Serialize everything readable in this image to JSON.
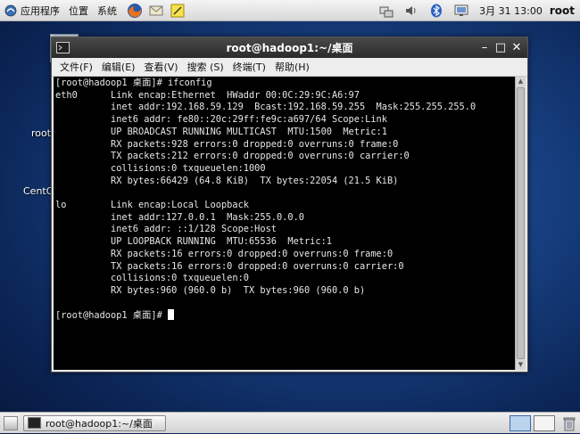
{
  "top_panel": {
    "applications": "应用程序",
    "places": "位置",
    "system": "系统",
    "launchers": [
      "firefox-icon",
      "email-icon",
      "notes-icon"
    ],
    "tray_icons": [
      "network-icon",
      "volume-icon",
      "bluetooth-icon",
      "display-icon"
    ],
    "clock": "3月 31 13:00",
    "user": "root"
  },
  "desktop": {
    "labels": [
      "root",
      "CentO"
    ]
  },
  "window": {
    "title": "root@hadoop1:~/桌面",
    "menu": [
      "文件(F)",
      "编辑(E)",
      "查看(V)",
      "搜索 (S)",
      "终端(T)",
      "帮助(H)"
    ],
    "terminal_lines": [
      "[root@hadoop1 桌面]# ifconfig",
      "eth0      Link encap:Ethernet  HWaddr 00:0C:29:9C:A6:97  ",
      "          inet addr:192.168.59.129  Bcast:192.168.59.255  Mask:255.255.255.0",
      "          inet6 addr: fe80::20c:29ff:fe9c:a697/64 Scope:Link",
      "          UP BROADCAST RUNNING MULTICAST  MTU:1500  Metric:1",
      "          RX packets:928 errors:0 dropped:0 overruns:0 frame:0",
      "          TX packets:212 errors:0 dropped:0 overruns:0 carrier:0",
      "          collisions:0 txqueuelen:1000 ",
      "          RX bytes:66429 (64.8 KiB)  TX bytes:22054 (21.5 KiB)",
      "",
      "lo        Link encap:Local Loopback  ",
      "          inet addr:127.0.0.1  Mask:255.0.0.0",
      "          inet6 addr: ::1/128 Scope:Host",
      "          UP LOOPBACK RUNNING  MTU:65536  Metric:1",
      "          RX packets:16 errors:0 dropped:0 overruns:0 frame:0",
      "          TX packets:16 errors:0 dropped:0 overruns:0 carrier:0",
      "          collisions:0 txqueuelen:0 ",
      "          RX bytes:960 (960.0 b)  TX bytes:960 (960.0 b)",
      "",
      "[root@hadoop1 桌面]# "
    ]
  },
  "bottom_panel": {
    "task_label": "root@hadoop1:~/桌面"
  },
  "colors": {
    "terminal_bg": "#000000",
    "terminal_fg": "#e6e6e6",
    "titlebar": "#333333",
    "desktop_blue": "#173f80"
  }
}
